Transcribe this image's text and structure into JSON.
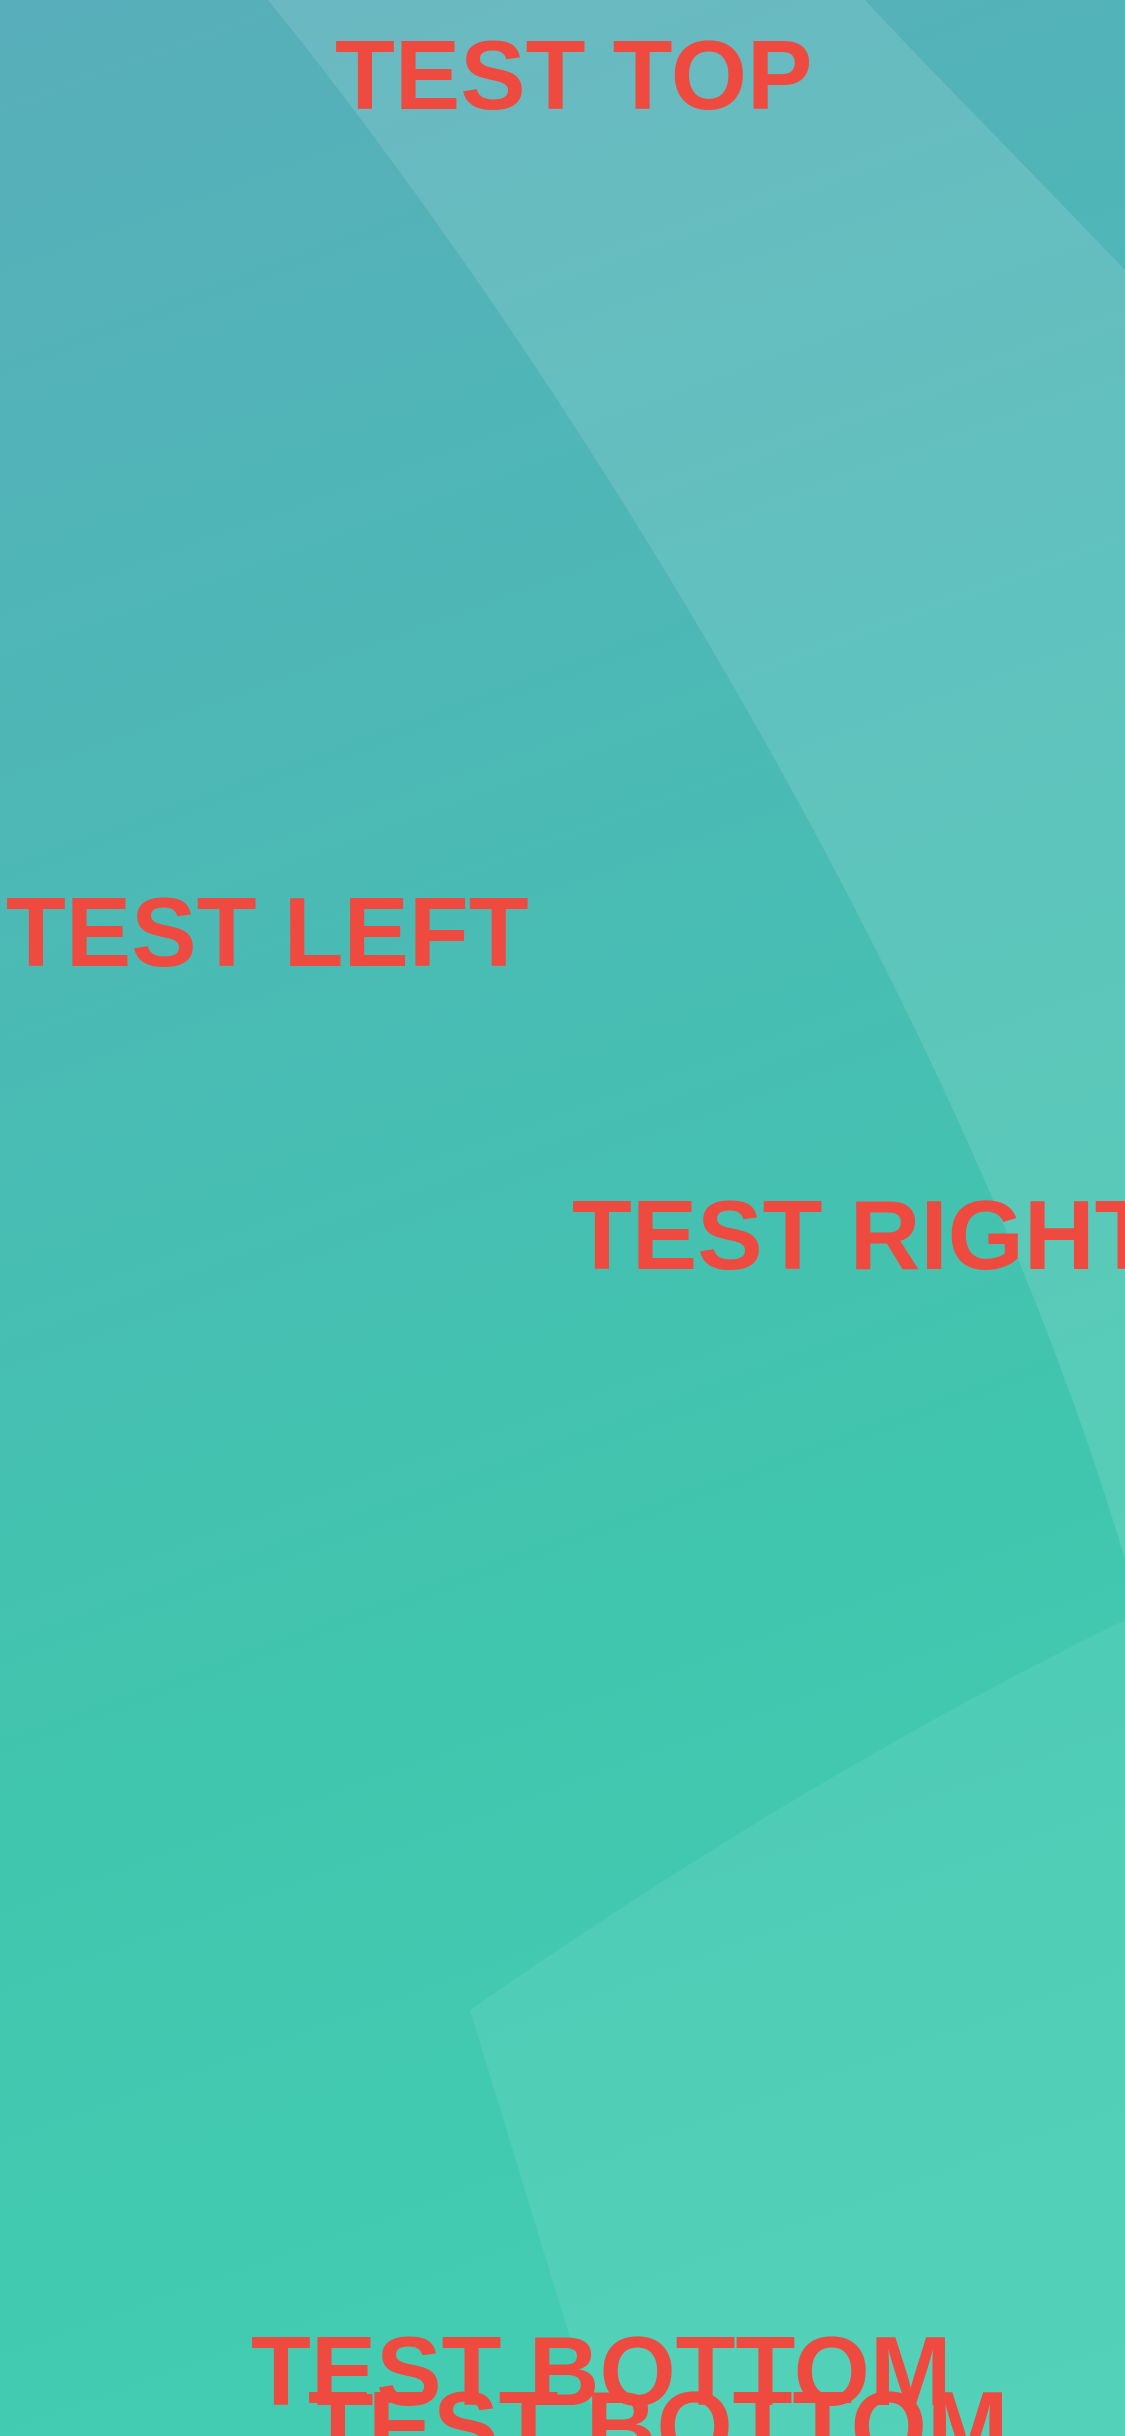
{
  "labels": {
    "top": "TEST TOP",
    "left": "TEST LEFT",
    "right": "TEST RIGHT",
    "bottom": "TEST BOTTOM",
    "bottom_duplicate": "TEST BOTTOM"
  },
  "colors": {
    "label_text": "#ee4a3f",
    "background_top": "#58aeba",
    "background_bottom": "#45cfb3"
  }
}
